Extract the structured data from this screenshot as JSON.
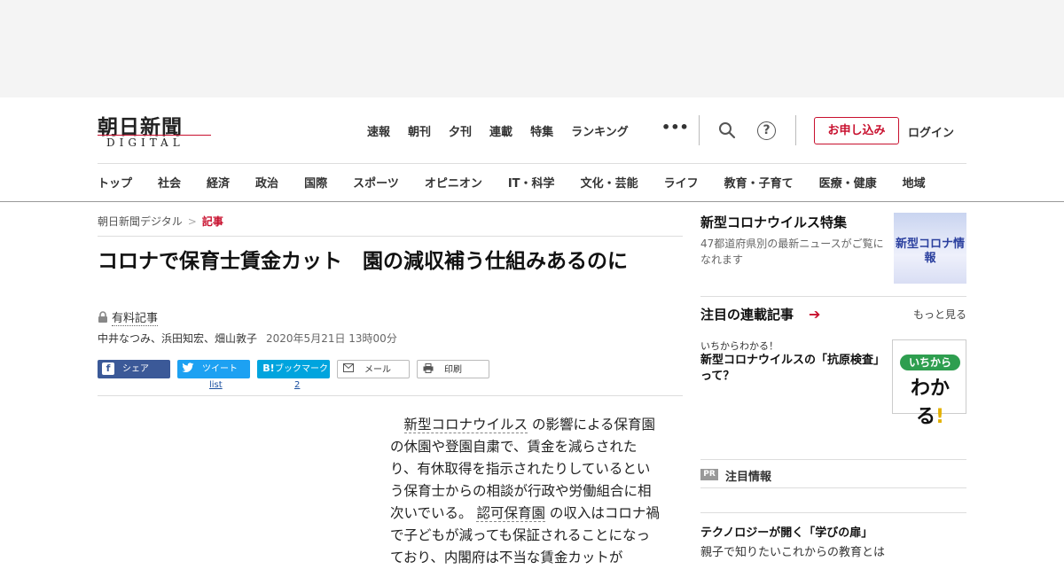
{
  "header": {
    "logo_main": "朝日新聞",
    "logo_sub": "DIGITAL",
    "topnav": [
      "速報",
      "朝刊",
      "夕刊",
      "連載",
      "特集",
      "ランキング"
    ],
    "more": "•••",
    "help": "?",
    "apply_label": "お申し込み",
    "login_label": "ログイン",
    "categories": [
      "トップ",
      "社会",
      "経済",
      "政治",
      "国際",
      "スポーツ",
      "オピニオン",
      "IT・科学",
      "文化・芸能",
      "ライフ",
      "教育・子育て",
      "医療・健康",
      "地域"
    ]
  },
  "breadcrumb": {
    "home": "朝日新聞デジタル",
    "sep": ">",
    "current": "記事"
  },
  "article": {
    "title": "コロナで保育士賃金カット　園の減収補う仕組みあるのに",
    "paid_label": "有料記事",
    "authors": "中井なつみ、浜田知宏、畑山敦子",
    "date": "2020年5月21日 13時00分",
    "body_kw1": "新型コロナウイルス",
    "body_part1": " の影響による保育園の休園や登園自粛で、賃金を減らされたり、有休取得を指示されたりしているという保育士からの相談が行政や労働組合に相次いでいる。 ",
    "body_kw2": "認可保育園",
    "body_part2": " の収入はコロナ禍で子どもが減っても保証されることになっており、内閣府は不当な賃金カットが"
  },
  "share": {
    "facebook": "シェア",
    "twitter": "ツイート",
    "twitter_count": "list",
    "hatena": "ブックマーク",
    "hatena_count": "2",
    "mail": "メール",
    "print": "印刷"
  },
  "sidebar": {
    "corona_title": "新型コロナウイルス特集",
    "corona_desc": "47都道府県別の最新ニュースがご覧になれます",
    "corona_thumb": "新型コロナ情報",
    "series_title": "注目の連載記事",
    "see_more": "もっと見る",
    "series_kicker": "いちからわかる！",
    "series_head": "新型コロナウイルスの「抗原検査」って？",
    "series_thumb_pill": "いちから",
    "series_thumb_big": "わかる",
    "series_thumb_mark": "!",
    "pr_badge": "PR",
    "pr_title": "注目情報",
    "pr_head": "テクノロジーが開く「学びの扉」",
    "pr_desc": "親子で知りたいこれからの教育とは"
  },
  "colors": {
    "brand_red": "#c8102e",
    "facebook": "#3b5998",
    "twitter": "#1da1f2",
    "hatena": "#00a4de"
  }
}
